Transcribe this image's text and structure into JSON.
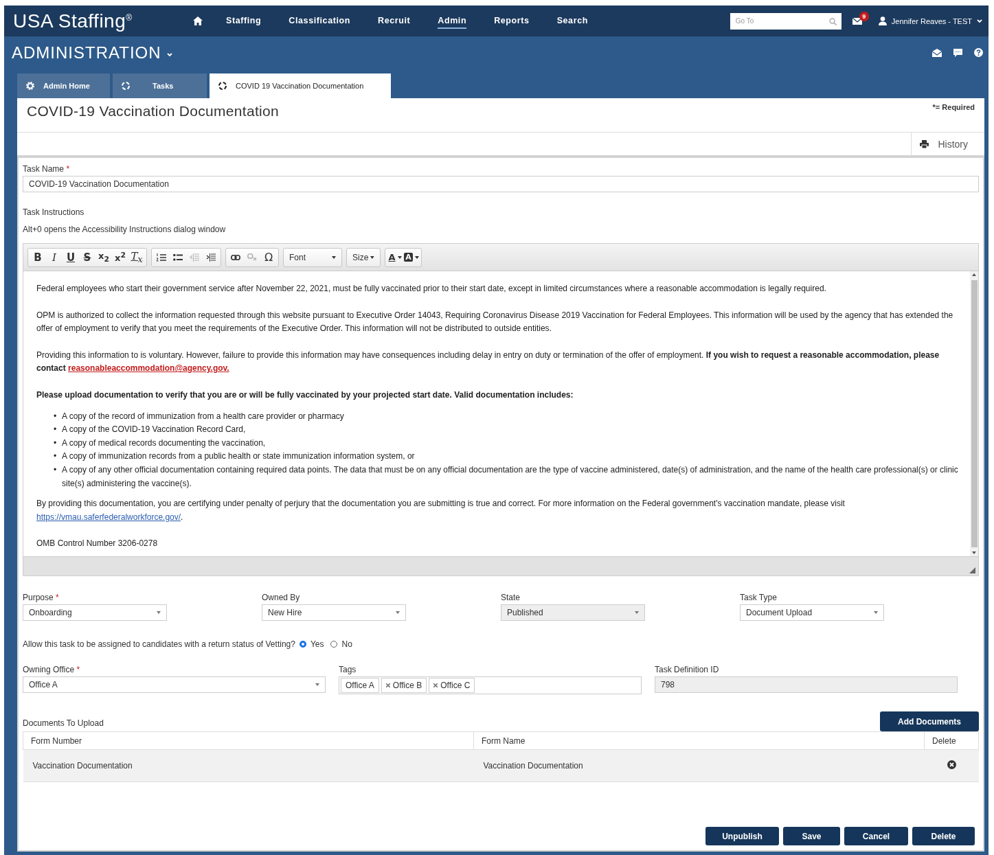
{
  "header": {
    "logo": "USA Staffing$^{®}$",
    "nav": [
      {
        "label": "Staffing",
        "selected": false
      },
      {
        "label": "Classification",
        "selected": false
      },
      {
        "label": "Recruit",
        "selected": false
      },
      {
        "label": "Admin",
        "selected": true
      },
      {
        "label": "Reports",
        "selected": false
      },
      {
        "label": "Search",
        "selected": false
      }
    ],
    "goto": {
      "placeholder": "Go To"
    },
    "mail_count": "9",
    "user": "Jennifer Reaves - TEST"
  },
  "section": {
    "title": "ADMINISTRATION"
  },
  "tabs": [
    {
      "label": "Admin Home",
      "selected": false,
      "kind": "gear"
    },
    {
      "label": "Tasks",
      "selected": false,
      "kind": "spinner"
    },
    {
      "label": "COVID 19 Vaccination Documentation",
      "selected": true,
      "kind": "spinner"
    }
  ],
  "page": {
    "title": "COVID-19 Vaccination Documentation",
    "required_note": "*= Required",
    "history": "History"
  },
  "task_name": {
    "label": "Task Name",
    "required": true,
    "value": "COVID-19 Vaccination Documentation"
  },
  "instructions": {
    "label": "Task Instructions",
    "hint": "Alt+0 opens the Accessibility Instructions dialog window",
    "toolbar": [
      [
        {
          "kind": "bold",
          "label": "B",
          "disabled": false
        },
        {
          "kind": "italic",
          "label": "I",
          "disabled": false
        },
        {
          "kind": "underline",
          "label": "U",
          "disabled": false
        },
        {
          "kind": "strike",
          "label": "S",
          "disabled": false
        },
        {
          "kind": "subscript",
          "label": "x$_{2}$",
          "disabled": false
        },
        {
          "kind": "superscript",
          "label": "x$^{2}$",
          "disabled": false
        },
        {
          "kind": "clear-format",
          "label": "T$_{x}$",
          "disabled": false
        }
      ],
      [
        {
          "kind": "numbered-list",
          "disabled": false
        },
        {
          "kind": "bullet-list",
          "disabled": false
        },
        {
          "kind": "outdent",
          "disabled": true
        },
        {
          "kind": "indent",
          "disabled": false
        }
      ],
      [
        {
          "kind": "link",
          "disabled": false
        },
        {
          "kind": "unlink",
          "disabled": true
        },
        {
          "kind": "special-char",
          "label": "Ω",
          "disabled": false
        }
      ],
      [
        {
          "kind": "dropdown",
          "label": "Font",
          "disabled": false
        }
      ],
      [
        {
          "kind": "dropdown",
          "label": "Size",
          "disabled": false
        }
      ],
      [
        {
          "kind": "text-color",
          "label": "A",
          "disabled": false
        },
        {
          "kind": "bg-color",
          "label": "A",
          "disabled": false
        }
      ]
    ],
    "content": [
      {
        "kind": "p",
        "text": "Federal employees who start their government service after November 22, 2021, must be fully vaccinated prior to their start date, except in limited circumstances where a reasonable accommodation is legally required."
      },
      {
        "kind": "p",
        "text": "OPM is authorized to collect the information requested through this website pursuant to Executive Order 14043, Requiring Coronavirus Disease 2019 Vaccination for Federal Employees. This information will be used by the agency that has extended the offer of employment to verify that you meet the requirements of the Executive Order. This information will not be distributed to outside entities."
      },
      {
        "kind": "p",
        "text": "Providing this information to is voluntary. However, failure to provide this information may have consequences including delay in entry on duty or termination of the offer of employment. **If you wish to request a reasonable accommodation, please contact**",
        "link": {
          "kind": "email",
          "text": "reasonableaccommodation@agency.gov."
        }
      },
      {
        "kind": "heading",
        "text": "Please upload documentation to verify that you are or will be fully vaccinated by your projected start date. Valid documentation includes:"
      },
      {
        "kind": "list",
        "marker": "•",
        "items": [
          "A copy of the record of immunization from a health care provider or pharmacy",
          "A copy of the COVID-19 Vaccination Record Card,",
          "A copy of medical records documenting the vaccination,",
          "A copy of immunization records from a public health or state immunization information system, or",
          "A copy of any other official documentation containing required data points. The data that must be on any official documentation are the type of vaccine administered, date(s) of administration, and the name of the health care professional(s) or clinic site(s) administering the vaccine(s)."
        ]
      },
      {
        "kind": "p",
        "text": "By providing this documentation, you are certifying under penalty of perjury that the documentation you are submitting is true and correct. For more information on the Federal government's vaccination mandate, please visit",
        "link": {
          "kind": "web",
          "text": "https://vmau.saferfederalworkforce.gov/"
        },
        "after": "."
      },
      {
        "kind": "p",
        "text": "OMB Control Number 3206-0278"
      }
    ]
  },
  "required_mark": "*",
  "selects": [
    {
      "label": "Purpose",
      "required": true,
      "value": "Onboarding",
      "disabled": false
    },
    {
      "label": "Owned By",
      "required": false,
      "value": "New Hire",
      "disabled": false
    },
    {
      "label": "State",
      "required": false,
      "value": "Published",
      "disabled": true
    },
    {
      "label": "Task Type",
      "required": false,
      "value": "Document Upload",
      "disabled": false
    }
  ],
  "vetting": {
    "question": "Allow this task to be assigned to candidates with a return status of Vetting?",
    "options": [
      {
        "label": "Yes",
        "selected": true
      },
      {
        "label": "No",
        "selected": false
      }
    ]
  },
  "owning_office": {
    "label": "Owning Office",
    "required": true,
    "value": "Office A"
  },
  "tags": {
    "label": "Tags",
    "chips": [
      {
        "label": "Office A",
        "removable": false
      },
      {
        "label": "Office B",
        "removable": true
      },
      {
        "label": "Office C",
        "removable": true
      }
    ]
  },
  "task_definition_id": {
    "label": "Task Definition ID",
    "value": "798",
    "disabled": true
  },
  "documents": {
    "label": "Documents To Upload",
    "add_button": "Add Documents",
    "columns": [
      "Form Number",
      "Form Name",
      "Delete"
    ],
    "rows": [
      {
        "form_number": "Vaccination Documentation",
        "form_name": "Vaccination Documentation"
      }
    ]
  },
  "actions": [
    "Unpublish",
    "Save",
    "Cancel",
    "Delete"
  ]
}
